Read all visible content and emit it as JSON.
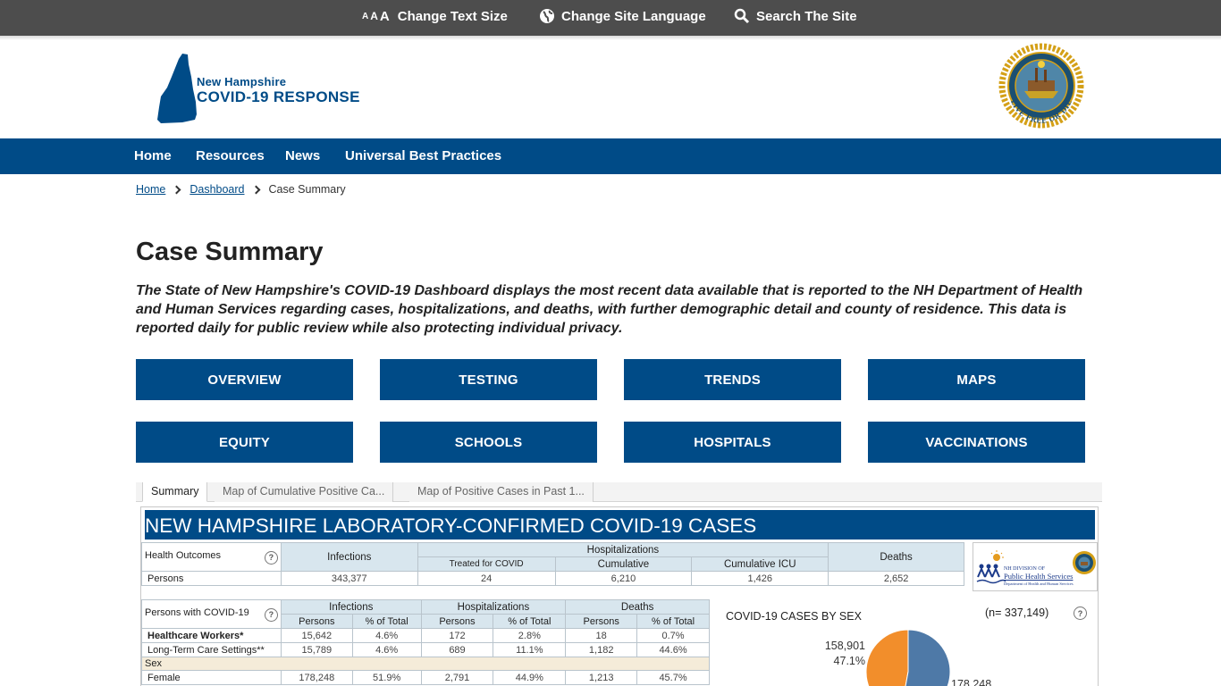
{
  "utility": {
    "text_size_label": "Change Text Size",
    "language_label": "Change Site Language",
    "search_label": "Search The Site",
    "aaa": [
      "A",
      "A",
      "A"
    ]
  },
  "logo": {
    "line1": "New Hampshire",
    "line2": "COVID-19 RESPONSE"
  },
  "seal": {
    "motto": "LIVE FREE OR DIE"
  },
  "nav": {
    "items": [
      "Home",
      "Resources",
      "News",
      "Universal Best Practices"
    ]
  },
  "breadcrumb": {
    "home": "Home",
    "dashboard": "Dashboard",
    "current": "Case Summary"
  },
  "page": {
    "title": "Case Summary",
    "intro": "The State of New Hampshire's COVID-19 Dashboard displays the most recent data available that is reported to the NH Department of Health and Human Services regarding cases, hospitalizations, and deaths, with further demographic detail and county of residence. This data is reported daily for public review while also protecting individual privacy."
  },
  "buttons": [
    "OVERVIEW",
    "TESTING",
    "TRENDS",
    "MAPS",
    "EQUITY",
    "SCHOOLS",
    "HOSPITALS",
    "VACCINATIONS"
  ],
  "tabs": [
    "Summary",
    "Map of Cumulative Positive Ca...",
    "Map of Positive Cases in Past 1..."
  ],
  "dashboard": {
    "header": "NEW HAMPSHIRE LABORATORY-CONFIRMED COVID-19 CASES",
    "outcomes": {
      "label": "Health Outcomes",
      "infections": "Infections",
      "hospitalizations": "Hospitalizations",
      "treated": "Treated for COVID",
      "cumulative": "Cumulative",
      "cumulative_icu": "Cumulative ICU",
      "deaths": "Deaths",
      "persons_label": "Persons",
      "persons_infections": "343,377",
      "persons_treated": "24",
      "persons_cumulative": "6,210",
      "persons_icu": "1,426",
      "persons_deaths": "2,652"
    },
    "persons": {
      "label": "Persons with COVID-19",
      "infections": "Infections",
      "hospitalizations": "Hospitalizations",
      "deaths": "Deaths",
      "col_persons": "Persons",
      "col_pct": "% of Total",
      "rows": [
        {
          "label": "Healthcare Workers*",
          "bold": true,
          "v": [
            "15,642",
            "4.6%",
            "172",
            "2.8%",
            "18",
            "0.7%"
          ]
        },
        {
          "label": "Long-Term Care Settings**",
          "bold": true,
          "v": [
            "15,789",
            "4.6%",
            "689",
            "11.1%",
            "1,182",
            "44.6%"
          ]
        }
      ],
      "sex_label": "Sex",
      "sex_rows": [
        {
          "label": "Female",
          "v": [
            "178,248",
            "51.9%",
            "2,791",
            "44.9%",
            "1,213",
            "45.7%"
          ]
        }
      ]
    },
    "phs_logo": {
      "line1": "NH DIVISION OF",
      "line2": "Public Health Services",
      "line3": "Department of Health and Human Services"
    },
    "sex_chart": {
      "title": "COVID-19 CASES BY SEX",
      "n": "(n= 337,149)",
      "left_value": "158,901",
      "left_pct": "47.1%",
      "right_value": "178,248"
    }
  },
  "chart_data": {
    "type": "pie",
    "title": "COVID-19 CASES BY SEX",
    "total": 337149,
    "slices": [
      {
        "label": "",
        "value": 158901,
        "percent": 47.1,
        "color": "#f28e2b"
      },
      {
        "label": "",
        "value": 178248,
        "percent": 52.9,
        "color": "#4e79a7"
      }
    ]
  },
  "colors": {
    "brand": "#004b87",
    "utility_bg": "#4d4d4d",
    "table_header": "#d8e6ee",
    "sex_row": "#f5ecd9",
    "pie_orange": "#f28e2b",
    "pie_blue": "#4e79a7"
  }
}
